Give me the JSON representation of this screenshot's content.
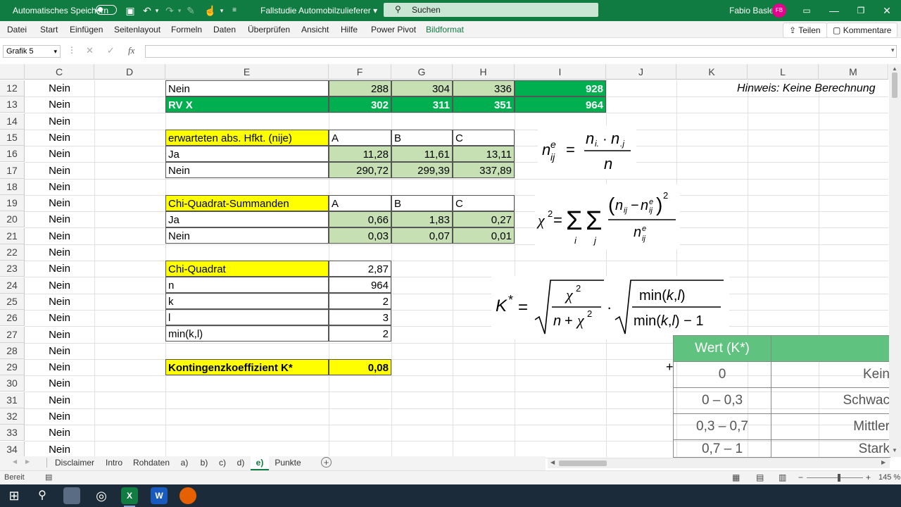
{
  "titlebar": {
    "autosave_label": "Automatisches Speichern",
    "file_name": "Fallstudie Automobilzulieferer",
    "search_placeholder": "Suchen",
    "user_name": "Fabio Basler",
    "user_initials": "FB"
  },
  "menu": {
    "items": [
      "Datei",
      "Start",
      "Einfügen",
      "Seitenlayout",
      "Formeln",
      "Daten",
      "Überprüfen",
      "Ansicht",
      "Hilfe",
      "Power Pivot",
      "Bildformat"
    ],
    "share_label": "Teilen",
    "comments_label": "Kommentare"
  },
  "formula_bar": {
    "name_box": "Grafik 5",
    "fx_label": "fx",
    "value": ""
  },
  "columns": [
    "C",
    "D",
    "E",
    "F",
    "G",
    "H",
    "I",
    "J",
    "K",
    "L",
    "M"
  ],
  "rows": [
    "12",
    "13",
    "14",
    "15",
    "16",
    "17",
    "18",
    "19",
    "20",
    "21",
    "22",
    "23",
    "24",
    "25",
    "26",
    "27",
    "28",
    "29",
    "30",
    "31",
    "32",
    "33",
    "34"
  ],
  "col_c_value": "Nein",
  "sheet": {
    "r12": {
      "e": "Nein",
      "f": "288",
      "g": "304",
      "h": "336",
      "i": "928"
    },
    "r13": {
      "e": "RV X",
      "f": "302",
      "g": "311",
      "h": "351",
      "i": "964"
    },
    "r15": {
      "e": "erwarteten abs. Hfkt. (nije)",
      "f": "A",
      "g": "B",
      "h": "C"
    },
    "r16": {
      "e": "Ja",
      "f": "11,28",
      "g": "11,61",
      "h": "13,11"
    },
    "r17": {
      "e": "Nein",
      "f": "290,72",
      "g": "299,39",
      "h": "337,89"
    },
    "r19": {
      "e": "Chi-Quadrat-Summanden",
      "f": "A",
      "g": "B",
      "h": "C"
    },
    "r20": {
      "e": "Ja",
      "f": "0,66",
      "g": "1,83",
      "h": "0,27"
    },
    "r21": {
      "e": "Nein",
      "f": "0,03",
      "g": "0,07",
      "h": "0,01"
    },
    "r23": {
      "e": "Chi-Quadrat",
      "f": "2,87"
    },
    "r24": {
      "e": "n",
      "f": "964"
    },
    "r25": {
      "e": "k",
      "f": "2"
    },
    "r26": {
      "e": "l",
      "f": "3"
    },
    "r27": {
      "e": "min(k,l)",
      "f": "2"
    },
    "r29": {
      "e": "Kontingenzkoeffizient K*",
      "f": "0,08"
    }
  },
  "hint_text": "Hinweis: Keine Berechnung",
  "interpretation": {
    "header": "Wert (K*)",
    "rows": [
      {
        "value": "0",
        "label": "Kein"
      },
      {
        "value": "0 – 0,3",
        "label": "Schwac"
      },
      {
        "value": "0,3 – 0,7",
        "label": "Mittler"
      },
      {
        "value": "0,7 – 1",
        "label": "Stark"
      }
    ]
  },
  "sheet_tabs": [
    "Disclaimer",
    "Intro",
    "Rohdaten",
    "a)",
    "b)",
    "c)",
    "d)",
    "e)",
    "Punkte"
  ],
  "active_tab": "e)",
  "status": {
    "ready": "Bereit",
    "zoom": "145 %"
  },
  "colors": {
    "excel_green": "#107c41",
    "yellow": "#ffff00",
    "light_green": "#c6e0b4",
    "dark_green": "#00b050"
  }
}
